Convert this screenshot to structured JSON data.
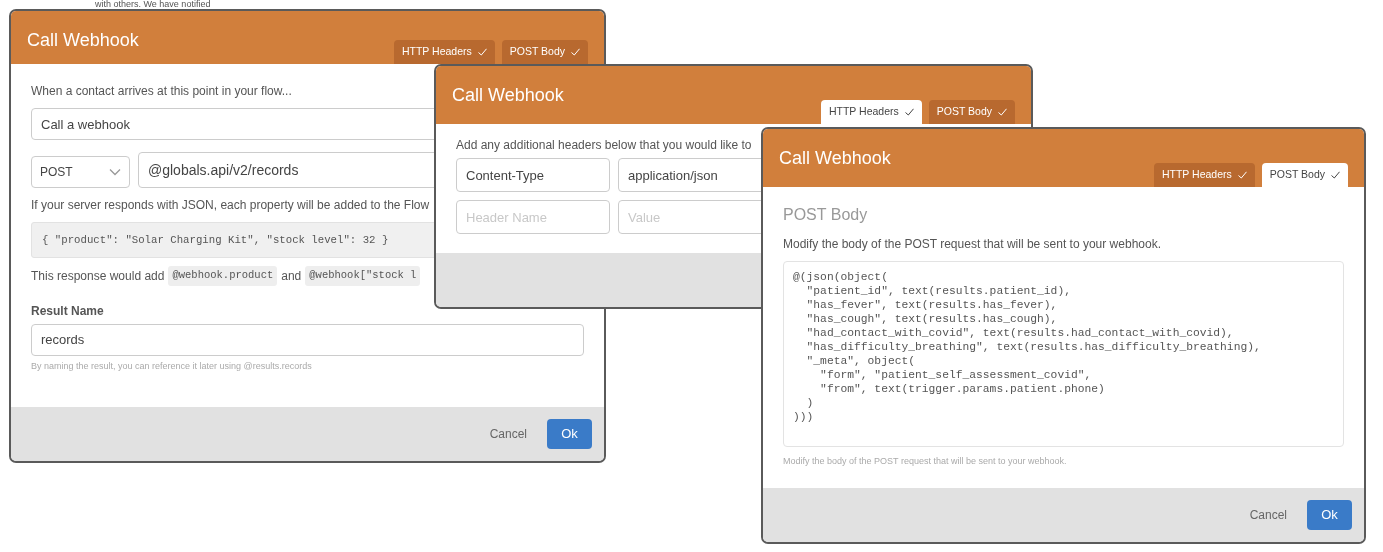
{
  "background_text": "with others. We have notified",
  "dialogs": [
    {
      "kind": "general",
      "title": "Call Webhook",
      "tabs": [
        {
          "label": "HTTP Headers",
          "selected": false
        },
        {
          "label": "POST Body",
          "selected": false
        }
      ],
      "intro": "When a contact arrives at this point in your flow...",
      "action_name": "Call a webhook",
      "method": "POST",
      "url": "@globals.api/v2/records",
      "json_hint": "If your server responds with JSON, each property will be added to the Flow",
      "sample_response": "{ \"product\": \"Solar Charging Kit\", \"stock level\": 32 }",
      "response_note": [
        {
          "kind": "text",
          "text": "This response would add"
        },
        {
          "kind": "code",
          "text": "@webhook.product"
        },
        {
          "kind": "text",
          "text": "and"
        },
        {
          "kind": "code",
          "text": "@webhook[\"stock l"
        }
      ],
      "result_label": "Result Name",
      "result_name": "records",
      "result_help": "By naming the result, you can reference it later using @results.records",
      "buttons": [
        {
          "label": "Cancel",
          "kind": "secondary"
        },
        {
          "label": "Ok",
          "kind": "primary"
        }
      ]
    },
    {
      "kind": "headers",
      "title": "Call Webhook",
      "tabs": [
        {
          "label": "HTTP Headers",
          "selected": true
        },
        {
          "label": "POST Body",
          "selected": false
        }
      ],
      "intro": "Add any additional headers below that you would like to",
      "headers": [
        {
          "name": {
            "value": "Content-Type"
          },
          "value": {
            "value": "application/json"
          }
        },
        {
          "name": {
            "placeholder": "Header Name"
          },
          "value": {
            "placeholder": "Value"
          }
        }
      ]
    },
    {
      "kind": "body",
      "title": "Call Webhook",
      "tabs": [
        {
          "label": "HTTP Headers",
          "selected": false
        },
        {
          "label": "POST Body",
          "selected": true
        }
      ],
      "heading": "POST Body",
      "intro": "Modify the body of the POST request that will be sent to your webhook.",
      "code_lines": [
        "@(json(object(",
        "  \"patient_id\", text(results.patient_id),",
        "  \"has_fever\", text(results.has_fever),",
        "  \"has_cough\", text(results.has_cough),",
        "  \"had_contact_with_covid\", text(results.had_contact_with_covid),",
        "  \"has_difficulty_breathing\", text(results.has_difficulty_breathing),",
        "  \"_meta\", object(",
        "    \"form\", \"patient_self_assessment_covid\",",
        "    \"from\", text(trigger.params.patient.phone)",
        "  )",
        ")))"
      ],
      "help": "Modify the body of the POST request that will be sent to your webhook.",
      "buttons": [
        {
          "label": "Cancel",
          "kind": "secondary"
        },
        {
          "label": "Ok",
          "kind": "primary"
        }
      ]
    }
  ]
}
